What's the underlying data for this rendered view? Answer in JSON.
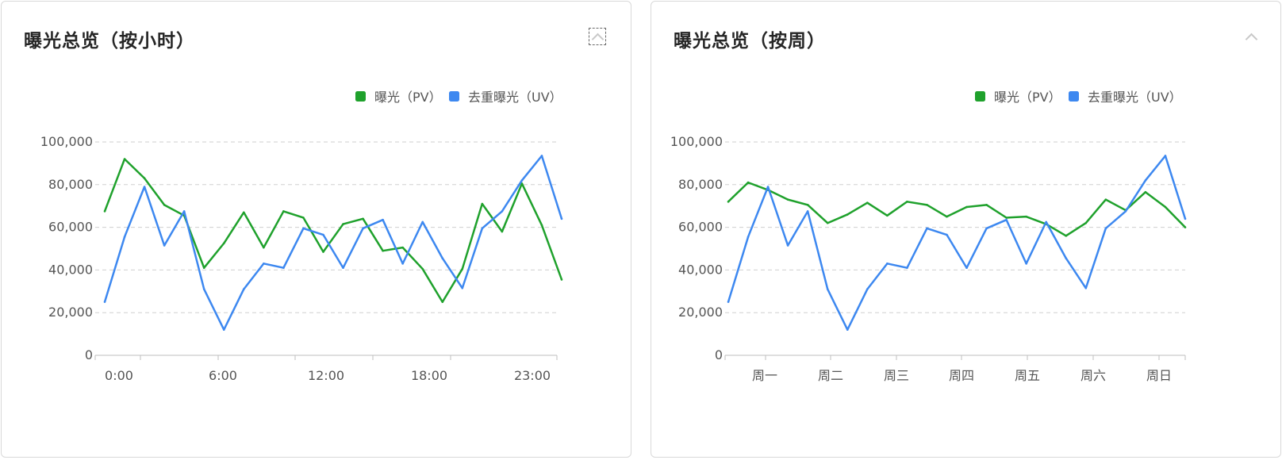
{
  "colors": {
    "pv": "#1fa12c",
    "uv": "#3d88f0",
    "grid": "#cfcfcf",
    "axis": "#bfbfbf"
  },
  "panels": [
    {
      "title": "曝光总览（按小时）",
      "collapse_icon": "chevron-up-icon",
      "legend": [
        {
          "label": "曝光（PV）",
          "color": "#1fa12c"
        },
        {
          "label": "去重曝光（UV）",
          "color": "#3d88f0"
        }
      ]
    },
    {
      "title": "曝光总览（按周）",
      "collapse_icon": "chevron-up-icon",
      "legend": [
        {
          "label": "曝光（PV）",
          "color": "#1fa12c"
        },
        {
          "label": "去重曝光（UV）",
          "color": "#3d88f0"
        }
      ]
    }
  ],
  "chart_data": [
    {
      "type": "line",
      "title": "曝光总览（按小时）",
      "ylim": [
        0,
        100000
      ],
      "yticks": [
        "0",
        "20,000",
        "40,000",
        "60,000",
        "80,000",
        "100,000"
      ],
      "x_tick_labels": [
        "0:00",
        "6:00",
        "12:00",
        "18:00",
        "23:00"
      ],
      "grid": true,
      "legend_position": "top-right",
      "series": [
        {
          "name": "曝光（PV）",
          "color": "#1fa12c",
          "values": [
            67500,
            92000,
            83000,
            70500,
            65500,
            41000,
            52500,
            67000,
            50500,
            67500,
            64500,
            48500,
            61500,
            64000,
            49000,
            50500,
            40500,
            25000,
            40500,
            71000,
            58000,
            80500,
            61000,
            35500
          ]
        },
        {
          "name": "去重曝光（UV）",
          "color": "#3d88f0",
          "values": [
            25000,
            55500,
            79000,
            51500,
            67500,
            31000,
            12000,
            31000,
            43000,
            41000,
            59500,
            56500,
            41000,
            59500,
            63500,
            43000,
            62500,
            45500,
            31500,
            59500,
            67500,
            82000,
            93500,
            64000
          ]
        }
      ]
    },
    {
      "type": "line",
      "title": "曝光总览（按周）",
      "ylim": [
        0,
        100000
      ],
      "yticks": [
        "0",
        "20,000",
        "40,000",
        "60,000",
        "80,000",
        "100,000"
      ],
      "x_tick_labels": [
        "周一",
        "周二",
        "周三",
        "周四",
        "周五",
        "周六",
        "周日"
      ],
      "grid": true,
      "legend_position": "top-right",
      "series": [
        {
          "name": "曝光（PV）",
          "color": "#1fa12c",
          "values": [
            72000,
            81000,
            77500,
            73000,
            70500,
            62000,
            66000,
            71500,
            65500,
            72000,
            70500,
            65000,
            69500,
            70500,
            64500,
            65000,
            61500,
            56000,
            62000,
            73000,
            68000,
            76500,
            69500,
            60000
          ]
        },
        {
          "name": "去重曝光（UV）",
          "color": "#3d88f0",
          "values": [
            25000,
            55500,
            79000,
            51500,
            67500,
            31000,
            12000,
            31000,
            43000,
            41000,
            59500,
            56500,
            41000,
            59500,
            63500,
            43000,
            62500,
            45500,
            31500,
            59500,
            67500,
            82000,
            93500,
            64000
          ]
        }
      ]
    }
  ]
}
